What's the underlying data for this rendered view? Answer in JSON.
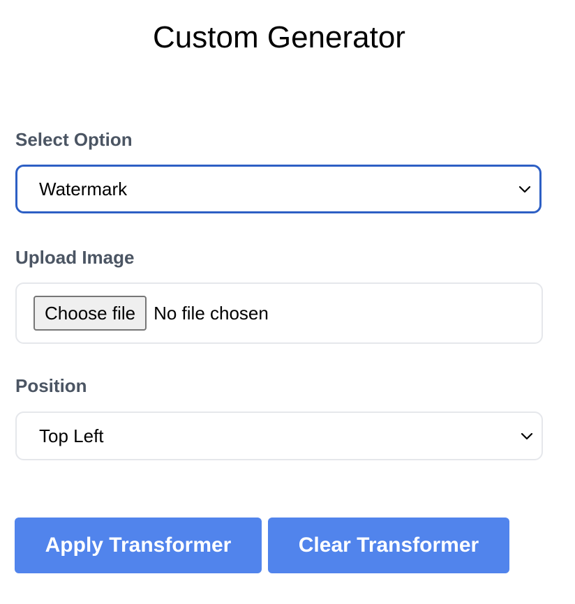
{
  "page": {
    "title": "Custom Generator"
  },
  "form": {
    "select_option": {
      "label": "Select Option",
      "selected": "Watermark"
    },
    "upload_image": {
      "label": "Upload Image",
      "button_label": "Choose file",
      "status": "No file chosen"
    },
    "position": {
      "label": "Position",
      "selected": "Top Left"
    }
  },
  "actions": {
    "apply_label": "Apply Transformer",
    "clear_label": "Clear Transformer"
  },
  "colors": {
    "primary_button": "#5184ec",
    "focus_border": "#2d5fc4",
    "label_text": "#4b5563"
  },
  "icons": {
    "dropdown": "chevron-down-icon"
  }
}
